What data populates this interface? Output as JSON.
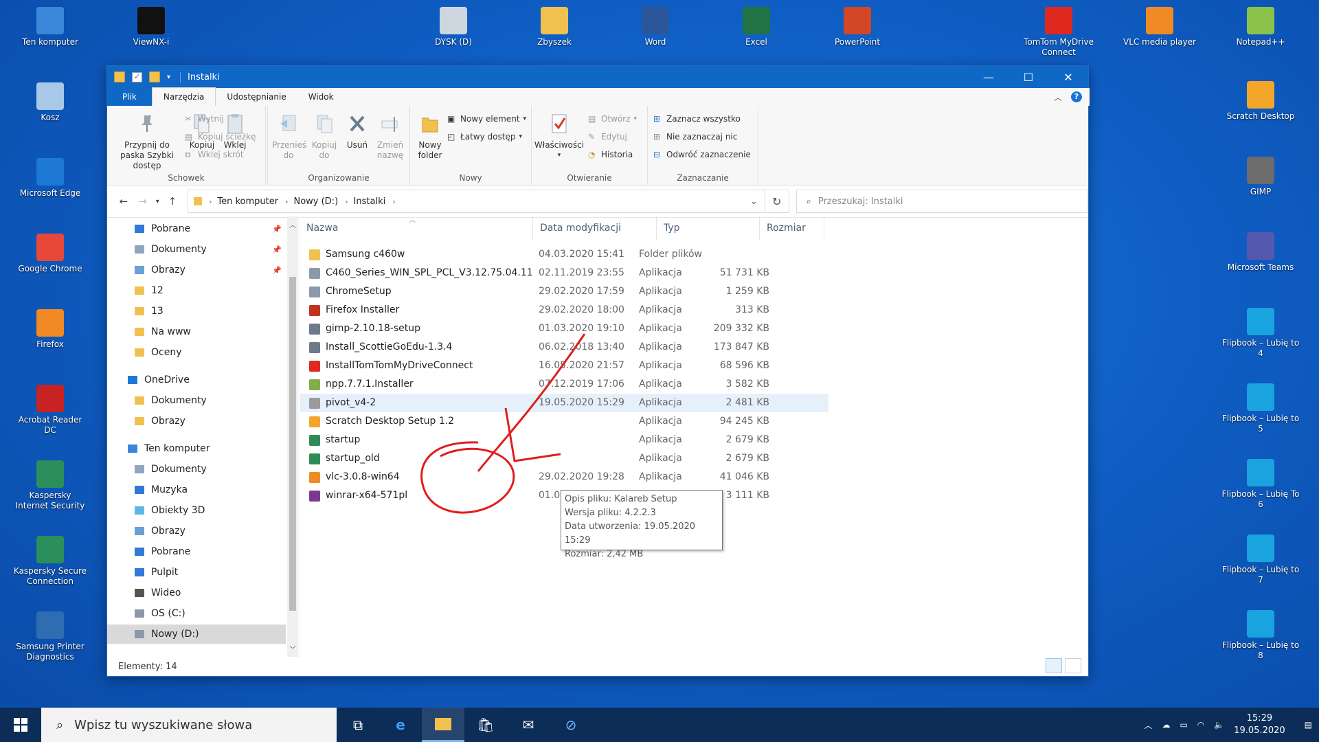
{
  "desktop": {
    "left_icons": [
      {
        "label": "Ten komputer",
        "color": "#3a86d8"
      },
      {
        "label": "Kosz",
        "color": "#a8c8e8"
      },
      {
        "label": "Microsoft Edge",
        "color": "#1e78d6"
      },
      {
        "label": "Google Chrome",
        "color": "#e7483a"
      },
      {
        "label": "Firefox",
        "color": "#f08a24"
      },
      {
        "label": "Acrobat Reader DC",
        "color": "#c92222"
      },
      {
        "label": "Kaspersky Internet Security",
        "color": "#2a8f5a"
      },
      {
        "label": "Kaspersky Secure Connection",
        "color": "#2a8f5a"
      },
      {
        "label": "Samsung Printer Diagnostics",
        "color": "#2f6db3"
      }
    ],
    "top_icons": [
      {
        "label": "ViewNX-i",
        "color": "#111111"
      },
      {
        "label": "DYSK (D)",
        "color": "#cdd6df"
      },
      {
        "label": "Zbyszek",
        "color": "#f1c14f"
      },
      {
        "label": "Word",
        "color": "#2b579a"
      },
      {
        "label": "Excel",
        "color": "#217346"
      },
      {
        "label": "PowerPoint",
        "color": "#d24726"
      },
      {
        "label": "TomTom MyDrive Connect",
        "color": "#e0281e"
      },
      {
        "label": "VLC media player",
        "color": "#f08a24"
      },
      {
        "label": "Notepad++",
        "color": "#8bc34a"
      }
    ],
    "right_icons": [
      {
        "label": "Scratch Desktop",
        "color": "#f4a62a"
      },
      {
        "label": "GIMP",
        "color": "#6c6c6c"
      },
      {
        "label": "Microsoft Teams",
        "color": "#5558af"
      },
      {
        "label": "Flipbook – Lubię to 4",
        "color": "#19a3df"
      },
      {
        "label": "Flipbook – Lubię to 5",
        "color": "#19a3df"
      },
      {
        "label": "Flipbook – Lubię To 6",
        "color": "#19a3df"
      },
      {
        "label": "Flipbook – Lubię to 7",
        "color": "#19a3df"
      },
      {
        "label": "Flipbook – Lubię to 8",
        "color": "#19a3df"
      }
    ]
  },
  "window": {
    "title": "Instalki",
    "tabs": [
      "Plik",
      "Narzędzia główne",
      "Udostępnianie",
      "Widok"
    ],
    "ribbon": {
      "schowek": {
        "label": "Schowek",
        "pin": "Przypnij do paska Szybki dostęp",
        "copy": "Kopiuj",
        "paste": "Wklej",
        "cut": "Wytnij",
        "copy_path": "Kopiuj ścieżkę",
        "paste_shortcut": "Wklej skrót"
      },
      "organizowanie": {
        "label": "Organizowanie",
        "move": "Przenieś do",
        "copy_to": "Kopiuj do",
        "delete": "Usuń",
        "rename": "Zmień nazwę"
      },
      "nowy": {
        "label": "Nowy",
        "new_folder": "Nowy folder",
        "new_item": "Nowy element",
        "easy_access": "Łatwy dostęp"
      },
      "otwieranie": {
        "label": "Otwieranie",
        "properties": "Właściwości",
        "open": "Otwórz",
        "edit": "Edytuj",
        "history": "Historia"
      },
      "zaznaczanie": {
        "label": "Zaznaczanie",
        "select_all": "Zaznacz wszystko",
        "select_none": "Nie zaznaczaj nic",
        "invert": "Odwróć zaznaczenie"
      }
    },
    "address": {
      "crumbs": [
        "Ten komputer",
        "Nowy (D:)",
        "Instalki"
      ],
      "search_placeholder": "Przeszukaj: Instalki"
    },
    "nav_pane": [
      {
        "label": "Pobrane",
        "pinned": true,
        "indent": 1,
        "color": "#2f7ad8"
      },
      {
        "label": "Dokumenty",
        "pinned": true,
        "indent": 1,
        "color": "#8fa6bf"
      },
      {
        "label": "Obrazy",
        "pinned": true,
        "indent": 1,
        "color": "#6aa0d4"
      },
      {
        "label": "12",
        "pinned": false,
        "indent": 1,
        "color": "#f1c14f"
      },
      {
        "label": "13",
        "pinned": false,
        "indent": 1,
        "color": "#f1c14f"
      },
      {
        "label": "Na www",
        "pinned": false,
        "indent": 1,
        "color": "#f1c14f"
      },
      {
        "label": "Oceny",
        "pinned": false,
        "indent": 1,
        "color": "#f1c14f"
      },
      {
        "label": "OneDrive",
        "pinned": false,
        "indent": 0,
        "color": "#1e78d6"
      },
      {
        "label": "Dokumenty",
        "pinned": false,
        "indent": 1,
        "color": "#f1c14f"
      },
      {
        "label": "Obrazy",
        "pinned": false,
        "indent": 1,
        "color": "#f1c14f"
      },
      {
        "label": "Ten komputer",
        "pinned": false,
        "indent": 0,
        "color": "#3a86d8"
      },
      {
        "label": "Dokumenty",
        "pinned": false,
        "indent": 1,
        "color": "#8fa6bf"
      },
      {
        "label": "Muzyka",
        "pinned": false,
        "indent": 1,
        "color": "#2f7ad8"
      },
      {
        "label": "Obiekty 3D",
        "pinned": false,
        "indent": 1,
        "color": "#5bb7e8"
      },
      {
        "label": "Obrazy",
        "pinned": false,
        "indent": 1,
        "color": "#6aa0d4"
      },
      {
        "label": "Pobrane",
        "pinned": false,
        "indent": 1,
        "color": "#2f7ad8"
      },
      {
        "label": "Pulpit",
        "pinned": false,
        "indent": 1,
        "color": "#2f7ad8"
      },
      {
        "label": "Wideo",
        "pinned": false,
        "indent": 1,
        "color": "#555555"
      },
      {
        "label": "OS (C:)",
        "pinned": false,
        "indent": 1,
        "color": "#8c98a6"
      },
      {
        "label": "Nowy (D:)",
        "pinned": false,
        "indent": 1,
        "color": "#8c98a6",
        "selected": true
      }
    ],
    "columns": [
      "Nazwa",
      "Data modyfikacji",
      "Typ",
      "Rozmiar"
    ],
    "files": [
      {
        "name": "Samsung c460w",
        "date": "04.03.2020 15:41",
        "type": "Folder plików",
        "size": "",
        "color": "#f1c14f"
      },
      {
        "name": "C460_Series_WIN_SPL_PCL_V3.12.75.04.11",
        "date": "02.11.2019 23:55",
        "type": "Aplikacja",
        "size": "51 731 KB",
        "color": "#8a9aab"
      },
      {
        "name": "ChromeSetup",
        "date": "29.02.2020 17:59",
        "type": "Aplikacja",
        "size": "1 259 KB",
        "color": "#8a9aab"
      },
      {
        "name": "Firefox Installer",
        "date": "29.02.2020 18:00",
        "type": "Aplikacja",
        "size": "313 KB",
        "color": "#c2331f"
      },
      {
        "name": "gimp-2.10.18-setup",
        "date": "01.03.2020 19:10",
        "type": "Aplikacja",
        "size": "209 332 KB",
        "color": "#6c7a8a"
      },
      {
        "name": "Install_ScottieGoEdu-1.3.4",
        "date": "06.02.2018 13:40",
        "type": "Aplikacja",
        "size": "173 847 KB",
        "color": "#6c7a8a"
      },
      {
        "name": "InstallTomTomMyDriveConnect",
        "date": "16.05.2020 21:57",
        "type": "Aplikacja",
        "size": "68 596 KB",
        "color": "#e0281e"
      },
      {
        "name": "npp.7.7.1.Installer",
        "date": "07.12.2019 17:06",
        "type": "Aplikacja",
        "size": "3 582 KB",
        "color": "#7fae4a"
      },
      {
        "name": "pivot_v4-2",
        "date": "19.05.2020 15:29",
        "type": "Aplikacja",
        "size": "2 481 KB",
        "color": "#9a9a9a",
        "hover": true
      },
      {
        "name": "Scratch Desktop Setup 1.2",
        "date": "",
        "type": "Aplikacja",
        "size": "94 245 KB",
        "color": "#f4a62a"
      },
      {
        "name": "startup",
        "date": "",
        "type": "Aplikacja",
        "size": "2 679 KB",
        "color": "#2e8b57"
      },
      {
        "name": "startup_old",
        "date": "",
        "type": "Aplikacja",
        "size": "2 679 KB",
        "color": "#2e8b57"
      },
      {
        "name": "vlc-3.0.8-win64",
        "date": "29.02.2020 19:28",
        "type": "Aplikacja",
        "size": "41 046 KB",
        "color": "#f08a24"
      },
      {
        "name": "winrar-x64-571pl",
        "date": "01.03.2020 17:10",
        "type": "Aplikacja",
        "size": "3 111 KB",
        "color": "#7a3b8f"
      }
    ],
    "tooltip": [
      "Opis pliku: Kalareb Setup",
      "Wersja pliku: 4.2.2.3",
      "Data utworzenia: 19.05.2020 15:29",
      "Rozmiar: 2,42 MB"
    ],
    "status": "Elementy: 14"
  },
  "taskbar": {
    "search_placeholder": "Wpisz tu wyszukiwane słowa",
    "time": "15:29",
    "date": "19.05.2020"
  }
}
